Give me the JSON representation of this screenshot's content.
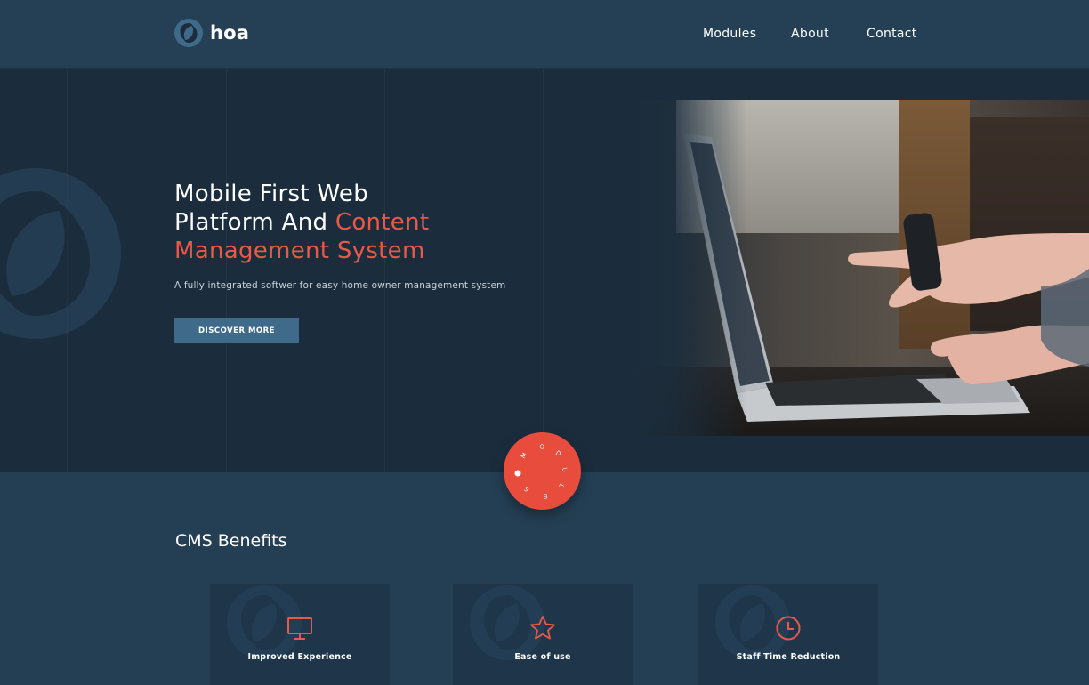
{
  "brand": {
    "name": "hoa",
    "icon": "hoa-logo-icon"
  },
  "nav": {
    "items": [
      "Modules",
      "About",
      "Contact"
    ]
  },
  "hero": {
    "title_line1": "Mobile First Web",
    "title_line2_plain": "Platform And ",
    "title_line2_accent": "Content",
    "title_line3_accent": "Management System",
    "subtitle": "A fully integrated softwer for easy home owner management system",
    "cta_label": "DISCOVER MORE",
    "image": "person-pointing-at-laptop-photo"
  },
  "modules_badge": {
    "letters": [
      "M",
      "O",
      "D",
      "U",
      "L",
      "E",
      "S"
    ],
    "text": "MODULES"
  },
  "benefits": {
    "title": "CMS Benefits",
    "cards": [
      {
        "label": "Improved Experience",
        "icon": "monitor-icon"
      },
      {
        "label": "Ease of use",
        "icon": "star-icon"
      },
      {
        "label": "Staff Time Reduction",
        "icon": "clock-icon"
      }
    ]
  },
  "colors": {
    "accent": "#e8594a",
    "header_bg": "#253f54",
    "hero_bg": "#1b2d3d",
    "button_bg": "#3f6a8a",
    "card_bg": "#1f364a"
  }
}
